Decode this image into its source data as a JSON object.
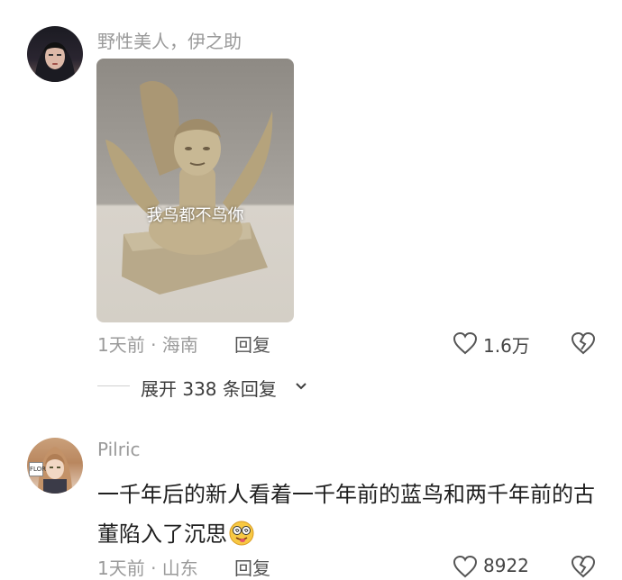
{
  "comments": [
    {
      "username": "野性美人，伊之助",
      "image_caption": "我鸟都不鸟你",
      "time_location": "1天前 · 海南",
      "reply_label": "回复",
      "like_count": "1.6万",
      "expand_label": "展开 338 条回复"
    },
    {
      "username": "Pilric",
      "text": "一千年后的新人看着一千年前的蓝鸟和两千年前的古董陷入了沉思",
      "emoji": "dizzy-face-emoji",
      "avatar_tag": "FLOR",
      "time_location": "1天前 · 山东",
      "reply_label": "回复",
      "like_count": "8922"
    }
  ],
  "icons": {
    "like": "heart-outline-icon",
    "dislike": "broken-heart-icon",
    "expand": "chevron-down-icon"
  }
}
